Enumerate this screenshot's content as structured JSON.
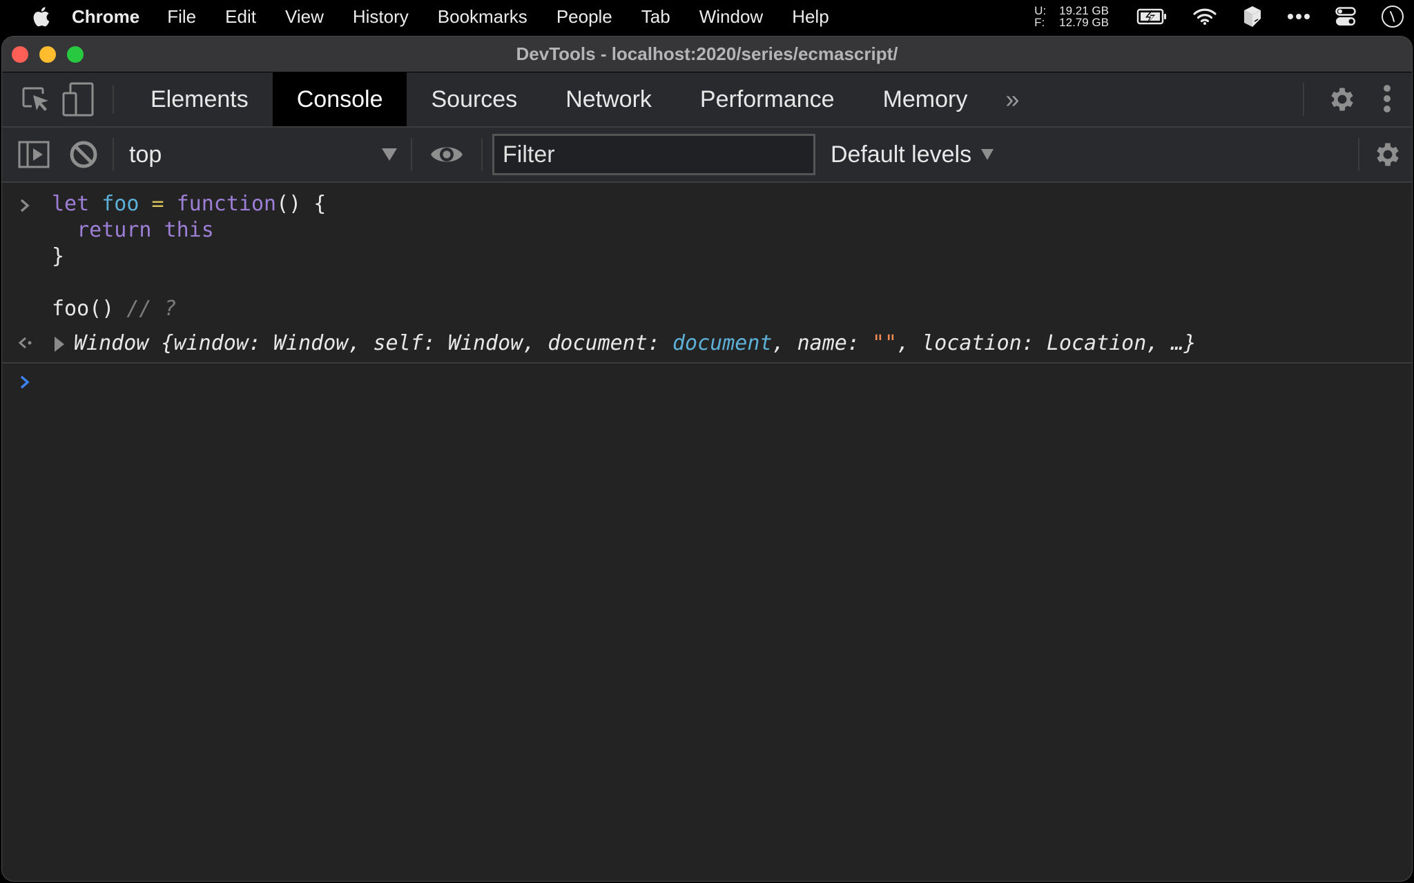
{
  "menubar": {
    "app_name": "Chrome",
    "items": [
      "File",
      "Edit",
      "View",
      "History",
      "Bookmarks",
      "People",
      "Tab",
      "Window",
      "Help"
    ],
    "memory": {
      "used_label": "U:",
      "used_value": "19.21 GB",
      "free_label": "F:",
      "free_value": "12.79 GB"
    },
    "tray_icons": [
      "battery-charging-icon",
      "wifi-icon",
      "box-icon",
      "more-icon",
      "control-center-icon",
      "clock-icon"
    ]
  },
  "window": {
    "title": "DevTools - localhost:2020/series/ecmascript/",
    "traffic_colors": {
      "close": "#ff5f57",
      "minimize": "#febc2e",
      "maximize": "#28c840"
    }
  },
  "devtools": {
    "tabs": [
      {
        "label": "Elements",
        "active": false
      },
      {
        "label": "Console",
        "active": true
      },
      {
        "label": "Sources",
        "active": false
      },
      {
        "label": "Network",
        "active": false
      },
      {
        "label": "Performance",
        "active": false
      },
      {
        "label": "Memory",
        "active": false
      }
    ],
    "more_tabs_label": "»"
  },
  "console_toolbar": {
    "context": "top",
    "filter_placeholder": "Filter",
    "filter_value": "",
    "levels": "Default levels"
  },
  "console": {
    "input": {
      "line1": {
        "kw1": "let",
        "var": "foo",
        "op": "=",
        "kw2": "function",
        "rest": "() {"
      },
      "line2": {
        "kw1": "return",
        "kw2": "this"
      },
      "line3": "}",
      "line5": {
        "code": "foo()",
        "comment": "// ?"
      }
    },
    "output": {
      "p1": "Window {window: Window, self: Window, document: ",
      "doc": "document",
      "p2": ", name: ",
      "str": "\"\"",
      "p3": ", location: Location, …}"
    }
  },
  "colors": {
    "keyword": "#9d7fd7",
    "variable": "#5db0d7",
    "operator": "#d9c25a",
    "string": "#f28b54",
    "prompt_active": "#3b82f6"
  }
}
